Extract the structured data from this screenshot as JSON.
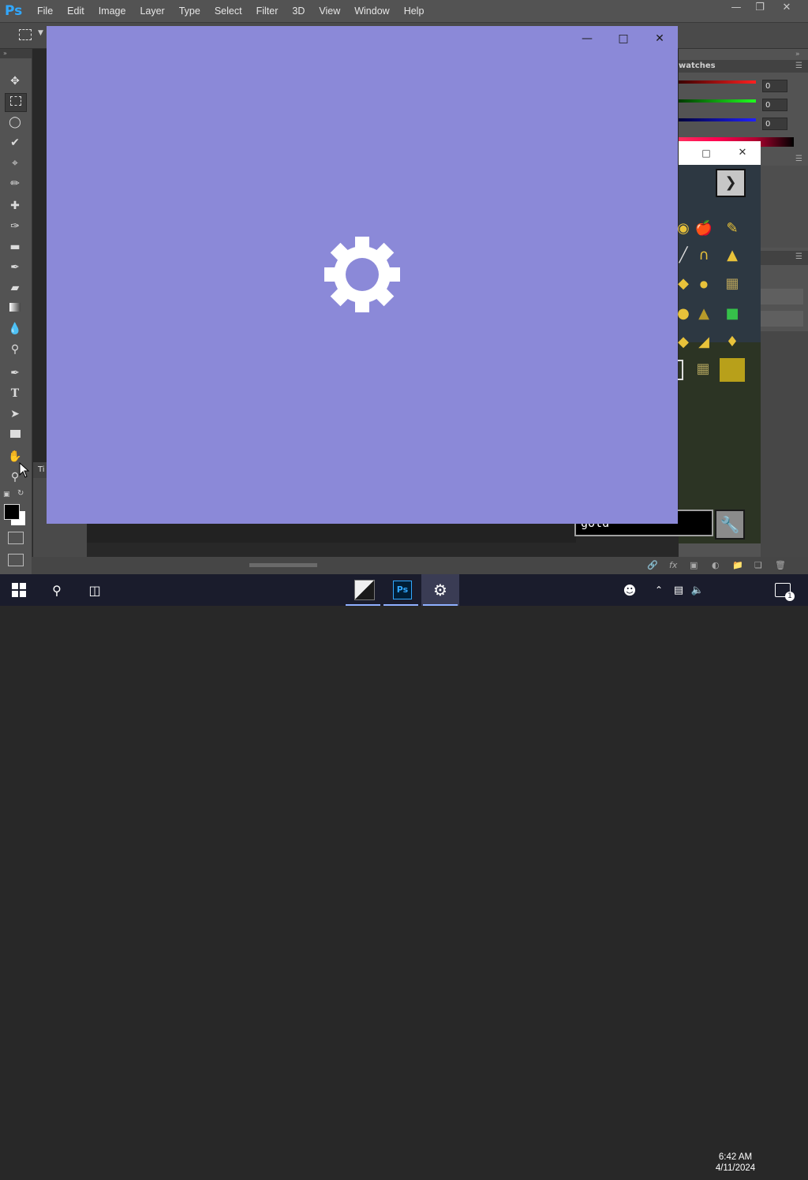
{
  "menubar": {
    "logo": "Ps",
    "items": [
      "File",
      "Edit",
      "Image",
      "Layer",
      "Type",
      "Select",
      "Filter",
      "3D",
      "View",
      "Window",
      "Help"
    ]
  },
  "right_panel": {
    "swatches_title": "watches",
    "rgb_values": [
      "0",
      "0",
      "0"
    ]
  },
  "minecraft": {
    "search_text": "gold"
  },
  "timeline_label": "Ti",
  "taskbar": {
    "time": "6:42 AM",
    "date": "4/11/2024",
    "notification_count": "1",
    "ps_label": "Ps"
  },
  "colors": {
    "splash_bg": "#8b89d8",
    "ps_blue": "#31a8ff",
    "taskbar_bg": "#1a1c2c"
  }
}
